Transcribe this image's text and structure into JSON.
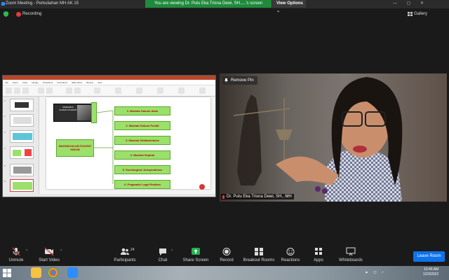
{
  "window": {
    "title": "Zoom Meeting - Perkuliahan MH AK 15",
    "controls": "— ▢ ✕"
  },
  "share_banner": {
    "viewing_text": "You are viewing Dr. Putu Eka Trisna Dewi, SH.,...'s screen",
    "view_options_label": "View Options ⌄"
  },
  "status": {
    "recording_label": "Recording",
    "gallery_label": "Gallery"
  },
  "slide": {
    "dark_box_label": "MAZHAB & ALIRAN FILSAFAT",
    "main_box_label": "MAZHAB DALAM FILSAFAT HUKUM",
    "items": [
      "1. Mazhab Hukum Alam",
      "2. Mazhab Hukum Positif",
      "3. Mazhab Utilitarianisme",
      "4. Mazhab Sejarah",
      "5. Sociological Jurisprudence",
      "6. Pragmatic Legal Realism"
    ]
  },
  "ppt": {
    "ribbon_tabs": [
      "File",
      "Home",
      "Insert",
      "Design",
      "Transitions",
      "Animations",
      "Slide Show",
      "Review",
      "View"
    ],
    "thumb_numbers": [
      "1",
      "2",
      "3",
      "4",
      "5",
      "6"
    ]
  },
  "video": {
    "remove_pin_label": "Remove Pin",
    "speaker_name": "Dr. Putu Eka Trisna Dewi, SH., MH"
  },
  "toolbar": {
    "unmute": "Unmute",
    "start_video": "Start Video",
    "participants": "Participants",
    "participants_count": "24",
    "chat": "Chat",
    "share_screen": "Share Screen",
    "record": "Record",
    "breakout_rooms": "Breakout Rooms",
    "reactions": "Reactions",
    "apps": "Apps",
    "whiteboards": "Whiteboards",
    "leave": "Leave Room"
  },
  "taskbar": {
    "time": "10:46 AM",
    "date": "12/3/2022"
  },
  "colors": {
    "share_banner": "#1f8a3b",
    "leave_button": "#0e72ed",
    "slide_box_fill": "#9be06a",
    "slide_text": "#b00000",
    "recording": "#e23c3c",
    "share_screen_icon": "#22b14c"
  }
}
